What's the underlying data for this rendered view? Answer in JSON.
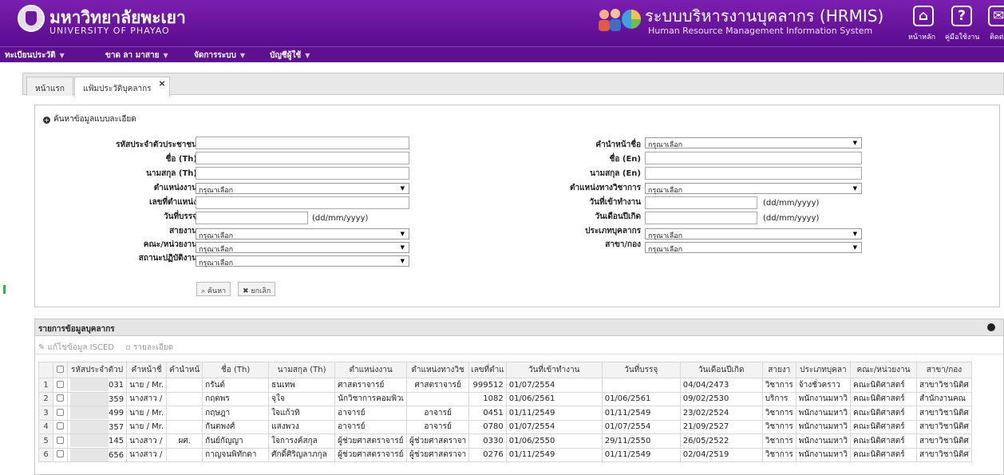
{
  "header": {
    "university_th": "มหาวิทยาลัยพะเยา",
    "university_en": "UNIVERSITY OF PHAYAO",
    "system_th": "ระบบบริหารงานบุคลากร (HRMIS)",
    "system_en": "Human Resource Management Information System",
    "buttons": [
      {
        "icon": "home-icon",
        "label": "หน้าหลัก"
      },
      {
        "icon": "help-icon",
        "label": "คู่มือใช้งาน"
      },
      {
        "icon": "mail-icon",
        "label": "ติดต่อ"
      }
    ]
  },
  "menu": [
    "ทะเบียนประวัติ",
    "ขาด ลา มาสาย",
    "จัดการระบบ",
    "บัญชีผู้ใช้"
  ],
  "tabs": [
    {
      "label": "หน้าแรก"
    },
    {
      "label": "แฟ้มประวัติบุคลากร",
      "close": "×"
    }
  ],
  "search": {
    "title": "ค้นหาข้อมูลแบบละเอียด",
    "left_fields": [
      {
        "label": "รหัสประจำตัวประชาชน",
        "type": "text"
      },
      {
        "label": "ชื่อ (Th)",
        "type": "text"
      },
      {
        "label": "นามสกุล (Th)",
        "type": "text"
      },
      {
        "label": "ตำแหน่งงาน",
        "type": "select",
        "value": "กรุณาเลือก"
      },
      {
        "label": "เลขที่ตำแหน่ง",
        "type": "text"
      },
      {
        "label": "วันที่บรรจุ",
        "type": "date",
        "hint": "(dd/mm/yyyy)"
      },
      {
        "label": "สายงาน",
        "type": "select",
        "value": "กรุณาเลือก"
      },
      {
        "label": "คณะ/หน่วยงาน",
        "type": "select",
        "value": "กรุณาเลือก"
      },
      {
        "label": "สถานะปฏิบัติงาน",
        "type": "select",
        "value": "กรุณาเลือก"
      }
    ],
    "right_fields": [
      {
        "label": "คำนำหน้าชื่อ",
        "type": "select",
        "value": "กรุณาเลือก"
      },
      {
        "label": "ชื่อ (En)",
        "type": "text"
      },
      {
        "label": "นามสกุล (En)",
        "type": "text"
      },
      {
        "label": "ตำแหน่งทางวิชาการ",
        "type": "select",
        "value": "กรุณาเลือก"
      },
      {
        "label": "วันที่เข้าทำงาน",
        "type": "date",
        "hint": "(dd/mm/yyyy)"
      },
      {
        "label": "วันเดือนปีเกิด",
        "type": "date",
        "hint": "(dd/mm/yyyy)"
      },
      {
        "label": "ประเภทบุคลากร",
        "type": "select",
        "value": "กรุณาเลือก"
      },
      {
        "label": "สาขา/กอง",
        "type": "select",
        "value": "กรุณาเลือก"
      }
    ],
    "search_button": "ค้นหา",
    "cancel_button": "ยกเลิก"
  },
  "results": {
    "title": "รายการข้อมูลบุคลากร",
    "toolbar": [
      "แก้ไขข้อมูล ISCED",
      "รายละเอียด"
    ],
    "columns": [
      "รหัสประจำตัวป",
      "คำหน้าชื่",
      "คำนำหน้",
      "ชื่อ (Th)",
      "นามสกุล (Th)",
      "ตำแหน่งงาน",
      "ตำแหน่งทางวิช",
      "เลขที่ตำแ",
      "วันที่เข้าทำงาน",
      "วันที่บรรจุ",
      "วันเดือนปีเกิด",
      "สายงา",
      "ประเภทบุคลา",
      "คณะ/หน่วยงาน",
      "สาขา/กอง"
    ],
    "rows": [
      [
        "1",
        "031",
        "นาย / Mr.",
        "",
        "กรันต์",
        "ธนเทพ",
        "ศาสตราจารย์",
        "ศาสตราจารย์",
        "999512",
        "01/07/2554",
        "",
        "04/04/2473",
        "วิชาการ",
        "จ้างชั่วคราว",
        "คณะนิติศาสตร์",
        "สาขาวิชานิติศ"
      ],
      [
        "2",
        "359",
        "นางสาว /",
        "",
        "กฤตพร",
        "จุใจ",
        "นักวิชาการคอมพิวเ",
        "",
        "1082",
        "01/06/2561",
        "01/06/2561",
        "09/02/2530",
        "บริการ",
        "พนักงานมหาวิ",
        "คณะนิติศาสตร์",
        "สำนักงานคณ"
      ],
      [
        "3",
        "499",
        "นาย / Mr.",
        "",
        "กฤษฎา",
        "ใจแก้วทิ",
        "อาจารย์",
        "อาจารย์",
        "0451",
        "01/11/2549",
        "01/11/2549",
        "23/02/2524",
        "วิชาการ",
        "พนักงานมหาวิ",
        "คณะนิติศาสตร์",
        "สาขาวิชานิติศ"
      ],
      [
        "4",
        "357",
        "นาย / Mr.",
        "",
        "กันตพงศ์",
        "แสงพวง",
        "อาจารย์",
        "อาจารย์",
        "0780",
        "01/07/2554",
        "01/07/2554",
        "21/09/2527",
        "วิชาการ",
        "พนักงานมหาวิ",
        "คณะนิติศาสตร์",
        "สาขาวิชานิติศ"
      ],
      [
        "5",
        "145",
        "นางสาว /",
        "ผศ.",
        "กันย์กัญญา",
        "ใจการงค์สกุล",
        "ผู้ช่วยศาสตราจารย์",
        "ผู้ช่วยศาสตราจา",
        "0330",
        "01/06/2550",
        "29/11/2550",
        "26/05/2522",
        "วิชาการ",
        "พนักงานมหาวิ",
        "คณะนิติศาสตร์",
        "สาขาวิชานิติศ"
      ],
      [
        "6",
        "656",
        "นางสาว /",
        "",
        "กาญจนพิทักดา",
        "ศักดิ์ศิริญลาภกุล",
        "ผู้ช่วยศาสตราจารย์",
        "ผู้ช่วยศาสตราจา",
        "0276",
        "01/11/2549",
        "01/11/2549",
        "02/04/2519",
        "วิชาการ",
        "พนักงานมหาวิ",
        "คณะนิติศาสตร์",
        "สาขาวิชานิติศ"
      ]
    ]
  },
  "colors": {
    "header": "#6b1aa0",
    "menubar": "#5d108f"
  }
}
